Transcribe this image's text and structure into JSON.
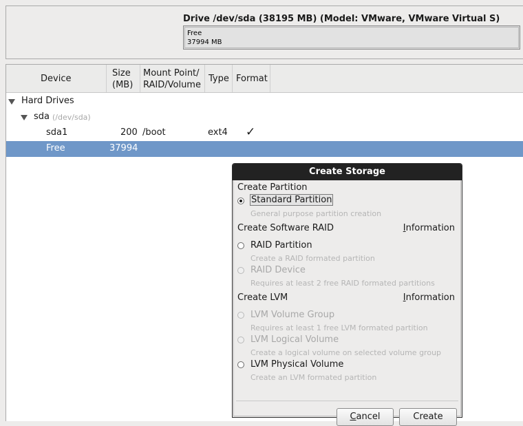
{
  "drive": {
    "title": "Drive /dev/sda (38195 MB) (Model: VMware, VMware Virtual S)",
    "segment_label": "Free",
    "segment_size": "37994 MB"
  },
  "table": {
    "columns": {
      "device": "Device",
      "size_line1": "Size",
      "size_line2": "(MB)",
      "mount_line1": "Mount Point/",
      "mount_line2": "RAID/Volume",
      "type": "Type",
      "format": "Format"
    },
    "hard_drives_label": "Hard Drives",
    "disk": {
      "name": "sda",
      "path": "(/dev/sda)"
    },
    "rows": [
      {
        "device": "sda1",
        "size": "200",
        "mount": "/boot",
        "type": "ext4",
        "format_mark": "✓"
      },
      {
        "device": "Free",
        "size": "37994",
        "mount": "",
        "type": "",
        "format_mark": ""
      }
    ]
  },
  "dialog": {
    "title": "Create Storage",
    "partition_section": "Create Partition",
    "standard_partition": {
      "label": "Standard Partition",
      "desc": "General purpose partition creation"
    },
    "raid_section": "Create Software RAID",
    "info_label": "Information",
    "info_label_first": "I",
    "info_label_rest": "nformation",
    "raid_partition": {
      "label": "RAID Partition",
      "desc": "Create a RAID formated partition"
    },
    "raid_device": {
      "label": "RAID Device",
      "desc": "Requires at least 2 free RAID formated partitions"
    },
    "lvm_section": "Create LVM",
    "lvm_volume_group": {
      "label": "LVM Volume Group",
      "desc": "Requires at least 1 free LVM formated partition"
    },
    "lvm_logical_volume": {
      "label": "LVM Logical Volume",
      "desc": "Create a logical volume on selected volume group"
    },
    "lvm_physical_volume": {
      "label": "LVM Physical Volume",
      "desc": "Create an LVM formated partition"
    },
    "cancel_first": "C",
    "cancel_rest": "ancel",
    "create_label": "Create"
  }
}
